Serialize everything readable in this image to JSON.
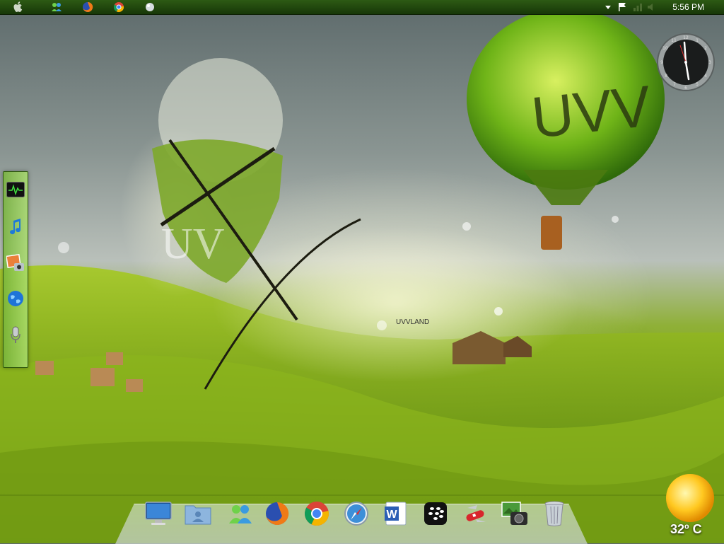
{
  "menubar": {
    "time": "5:56 PM",
    "icons": [
      "apple-icon",
      "messenger-icon",
      "firefox-icon",
      "chrome-icon",
      "globe-icon"
    ],
    "tray_icons": [
      "dropdown-arrow-icon",
      "flag-icon",
      "network-icon",
      "volume-icon"
    ]
  },
  "wallpaper": {
    "balloon_text": "UVV",
    "island_text": "UV",
    "sign_text": "UVVLAND"
  },
  "left_dock": {
    "items": [
      "activity-monitor-icon",
      "itunes-icon",
      "iphoto-icon",
      "safari-globe-icon",
      "microphone-icon"
    ]
  },
  "dock": {
    "items": [
      "monitor-icon",
      "user-folder-icon",
      "messenger-icon",
      "firefox-icon",
      "chrome-icon",
      "safari-icon",
      "word-icon",
      "blackberry-icon",
      "swiss-knife-icon",
      "photo-camera-icon",
      "trash-icon"
    ]
  },
  "weather": {
    "temperature": "32º C"
  },
  "colors": {
    "menubar": "#1f4510",
    "grass": "#7aa21a",
    "balloon_green": "#7fbf1e"
  }
}
